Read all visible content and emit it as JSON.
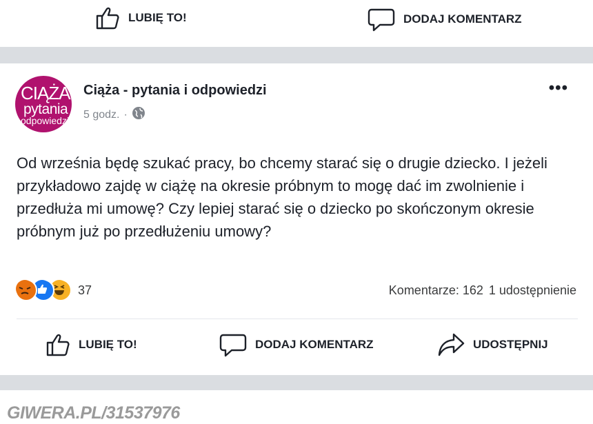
{
  "top_bar": {
    "like_label": "LUBIĘ TO!",
    "comment_label": "DODAJ KOMENTARZ"
  },
  "post": {
    "avatar": {
      "line1": "CIĄŻA",
      "line2": "pytania",
      "line3": "odpowiedzi"
    },
    "page_name": "Ciąża - pytania i odpowiedzi",
    "time": "5 godz.",
    "dot": "·",
    "privacy_icon": "globe-icon",
    "more_label": "•••",
    "text": "Od września będę szukać pracy, bo chcemy starać się o drugie dziecko. I jeżeli przykładowo zajdę w ciążę na okresie próbnym to mogę dać im zwolnienie i przedłuża mi umowę? Czy lepiej starać się o dziecko po skończonym okresie próbnym już po przedłużeniu umowy?",
    "reactions": {
      "icons": [
        "angry-icon",
        "like-icon",
        "haha-icon"
      ],
      "count": "37"
    },
    "comments": "Komentarze: 162",
    "shares": "1 udostępnienie",
    "actions": {
      "like": "LUBIĘ TO!",
      "comment": "DODAJ KOMENTARZ",
      "share": "UDOSTĘPNIJ"
    }
  },
  "watermark": "GIWERA.PL/31537976",
  "colors": {
    "avatar": "#b0126e",
    "separator": "#dadde1",
    "like_blue": "#1877f2",
    "angry": "#e9710f",
    "haha": "#f7b125"
  }
}
